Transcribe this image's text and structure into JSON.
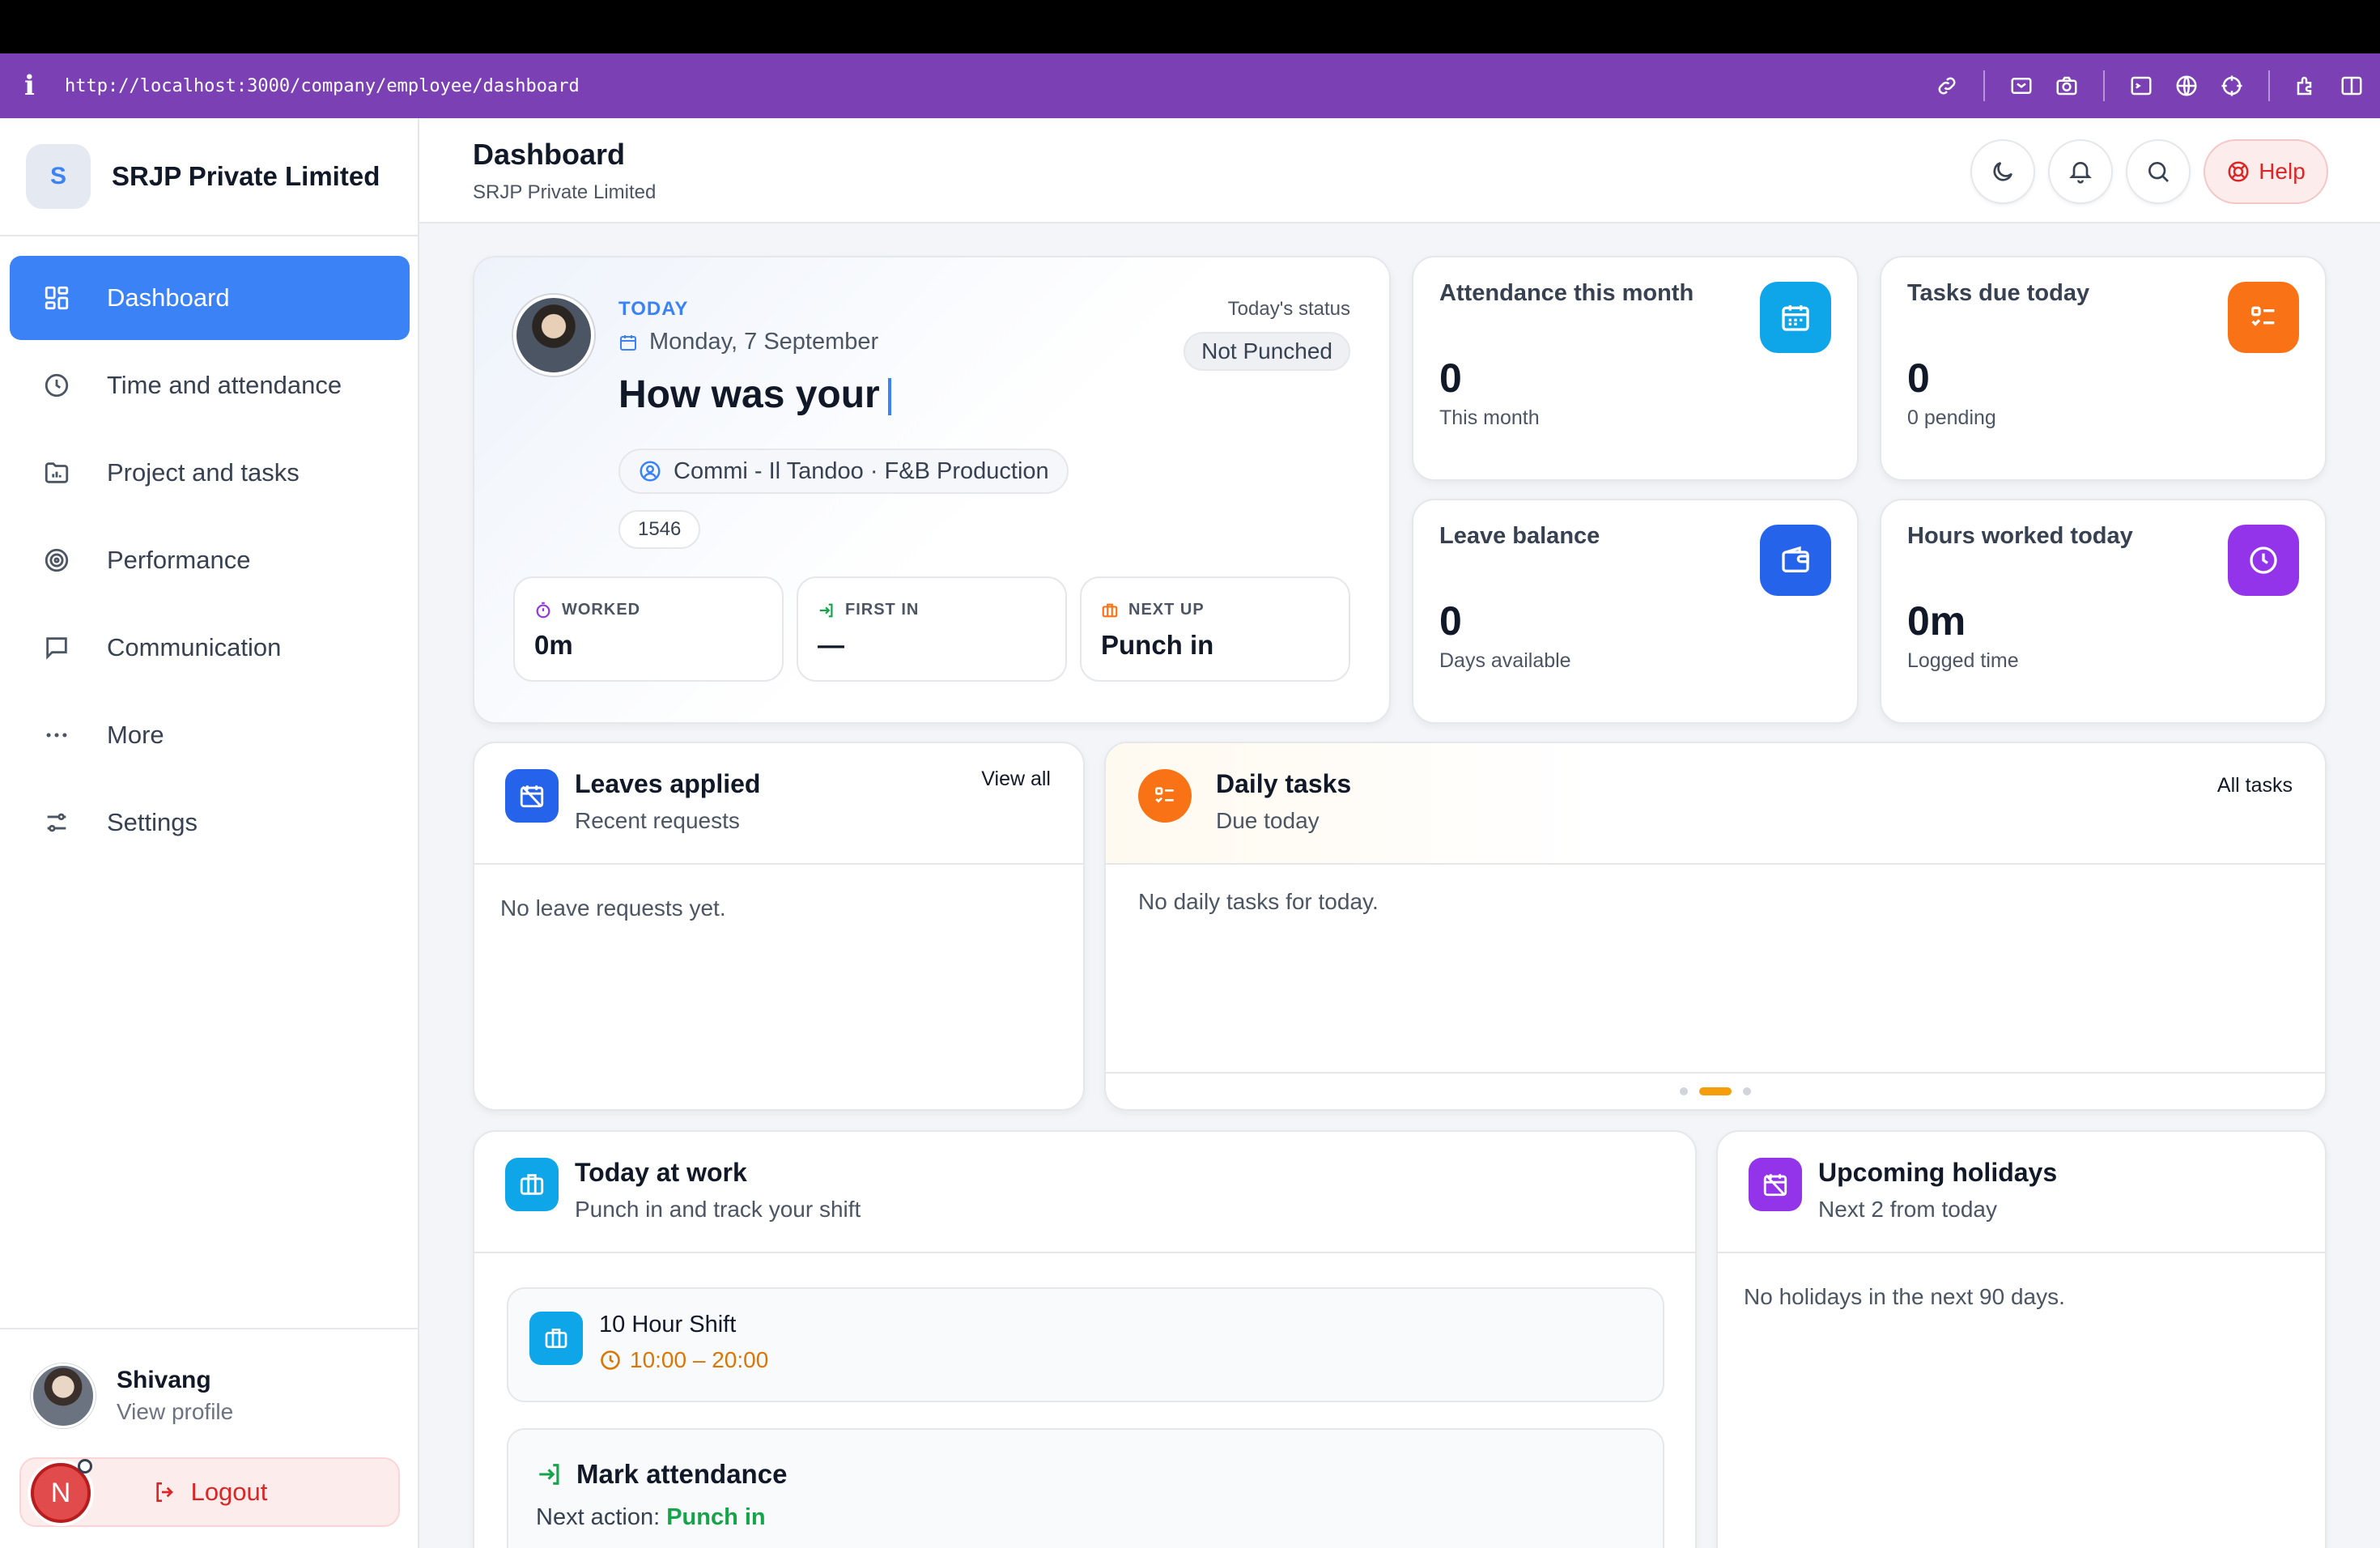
{
  "browser": {
    "url": "http://localhost:3000/company/employee/dashboard"
  },
  "company": {
    "initial": "S",
    "name": "SRJP Private Limited"
  },
  "sidebar": {
    "items": [
      {
        "label": "Dashboard",
        "icon": "grid-icon",
        "active": true
      },
      {
        "label": "Time and attendance",
        "icon": "clock-icon"
      },
      {
        "label": "Project and tasks",
        "icon": "folder-chart-icon"
      },
      {
        "label": "Performance",
        "icon": "target-icon"
      },
      {
        "label": "Communication",
        "icon": "message-icon"
      },
      {
        "label": "More",
        "icon": "more-dots-icon"
      },
      {
        "label": "Settings",
        "icon": "sliders-icon"
      }
    ],
    "user": {
      "name": "Shivang",
      "link": "View profile"
    },
    "logout": "Logout",
    "next_badge": "N"
  },
  "header": {
    "title": "Dashboard",
    "subtitle": "SRJP Private Limited",
    "help": "Help"
  },
  "hero": {
    "today_label": "TODAY",
    "date": "Monday, 7 September",
    "greeting": "How was your",
    "status_label": "Today's status",
    "status": "Not Punched",
    "role": "Commi - Il Tandoo · F&B Production",
    "employee_id": "1546",
    "worked": {
      "label": "WORKED",
      "value": "0m"
    },
    "first_in": {
      "label": "FIRST IN",
      "value": "—"
    },
    "next_up": {
      "label": "NEXT UP",
      "value": "Punch in"
    }
  },
  "stats": [
    {
      "label": "Attendance this month",
      "value": "0",
      "sub": "This month",
      "color": "#0ea5e9"
    },
    {
      "label": "Tasks due today",
      "value": "0",
      "sub": "0 pending",
      "color": "#f97316"
    },
    {
      "label": "Leave balance",
      "value": "0",
      "sub": "Days available",
      "color": "#2563eb"
    },
    {
      "label": "Hours worked today",
      "value": "0m",
      "sub": "Logged time",
      "color": "#9333ea"
    }
  ],
  "leaves": {
    "title": "Leaves applied",
    "subtitle": "Recent requests",
    "link": "View all",
    "empty": "No leave requests yet."
  },
  "daily": {
    "title": "Daily tasks",
    "subtitle": "Due today",
    "link": "All tasks",
    "empty": "No daily tasks for today."
  },
  "work": {
    "title": "Today at work",
    "subtitle": "Punch in and track your shift",
    "shift_name": "10 Hour Shift",
    "shift_time": "10:00 – 20:00",
    "mark_title": "Mark attendance",
    "next_action_label": "Next action:",
    "next_action": "Punch in"
  },
  "holidays": {
    "title": "Upcoming holidays",
    "subtitle": "Next 2 from today",
    "empty": "No holidays in the next 90 days."
  }
}
